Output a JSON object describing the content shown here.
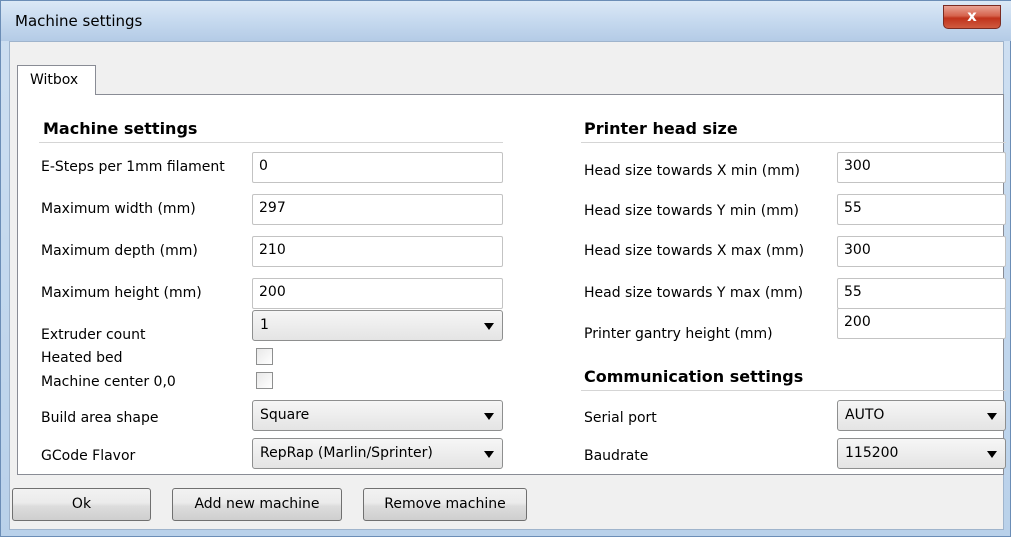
{
  "window": {
    "title": "Machine settings",
    "close_glyph": "x"
  },
  "tabs": [
    {
      "label": "Witbox",
      "active": true
    }
  ],
  "machine_settings": {
    "title": "Machine settings",
    "esteps": {
      "label": "E-Steps per 1mm filament",
      "value": "0"
    },
    "max_width": {
      "label": "Maximum width (mm)",
      "value": "297"
    },
    "max_depth": {
      "label": "Maximum depth (mm)",
      "value": "210"
    },
    "max_height": {
      "label": "Maximum height (mm)",
      "value": "200"
    },
    "extruder_count": {
      "label": "Extruder count",
      "value": "1"
    },
    "heated_bed": {
      "label": "Heated bed",
      "checked": false
    },
    "machine_center": {
      "label": "Machine center 0,0",
      "checked": false
    },
    "build_area_shape": {
      "label": "Build area shape",
      "value": "Square"
    },
    "gcode_flavor": {
      "label": "GCode Flavor",
      "value": "RepRap (Marlin/Sprinter)"
    }
  },
  "printer_head": {
    "title": "Printer head size",
    "x_min": {
      "label": "Head size towards X min (mm)",
      "value": "300"
    },
    "y_min": {
      "label": "Head size towards Y min (mm)",
      "value": "55"
    },
    "x_max": {
      "label": "Head size towards X max (mm)",
      "value": "300"
    },
    "y_max": {
      "label": "Head size towards Y max (mm)",
      "value": "55"
    },
    "gantry_height": {
      "label": "Printer gantry height (mm)",
      "value": "200"
    }
  },
  "communication": {
    "title": "Communication settings",
    "serial_port": {
      "label": "Serial port",
      "value": "AUTO"
    },
    "baudrate": {
      "label": "Baudrate",
      "value": "115200"
    }
  },
  "buttons": {
    "ok": "Ok",
    "add_machine": "Add new machine",
    "remove_machine": "Remove machine"
  },
  "colors": {
    "title_bar": "#c4d8ee",
    "close_button": "#c0331c",
    "panel_bg": "#ffffff",
    "dialog_bg": "#f0f0f0"
  }
}
